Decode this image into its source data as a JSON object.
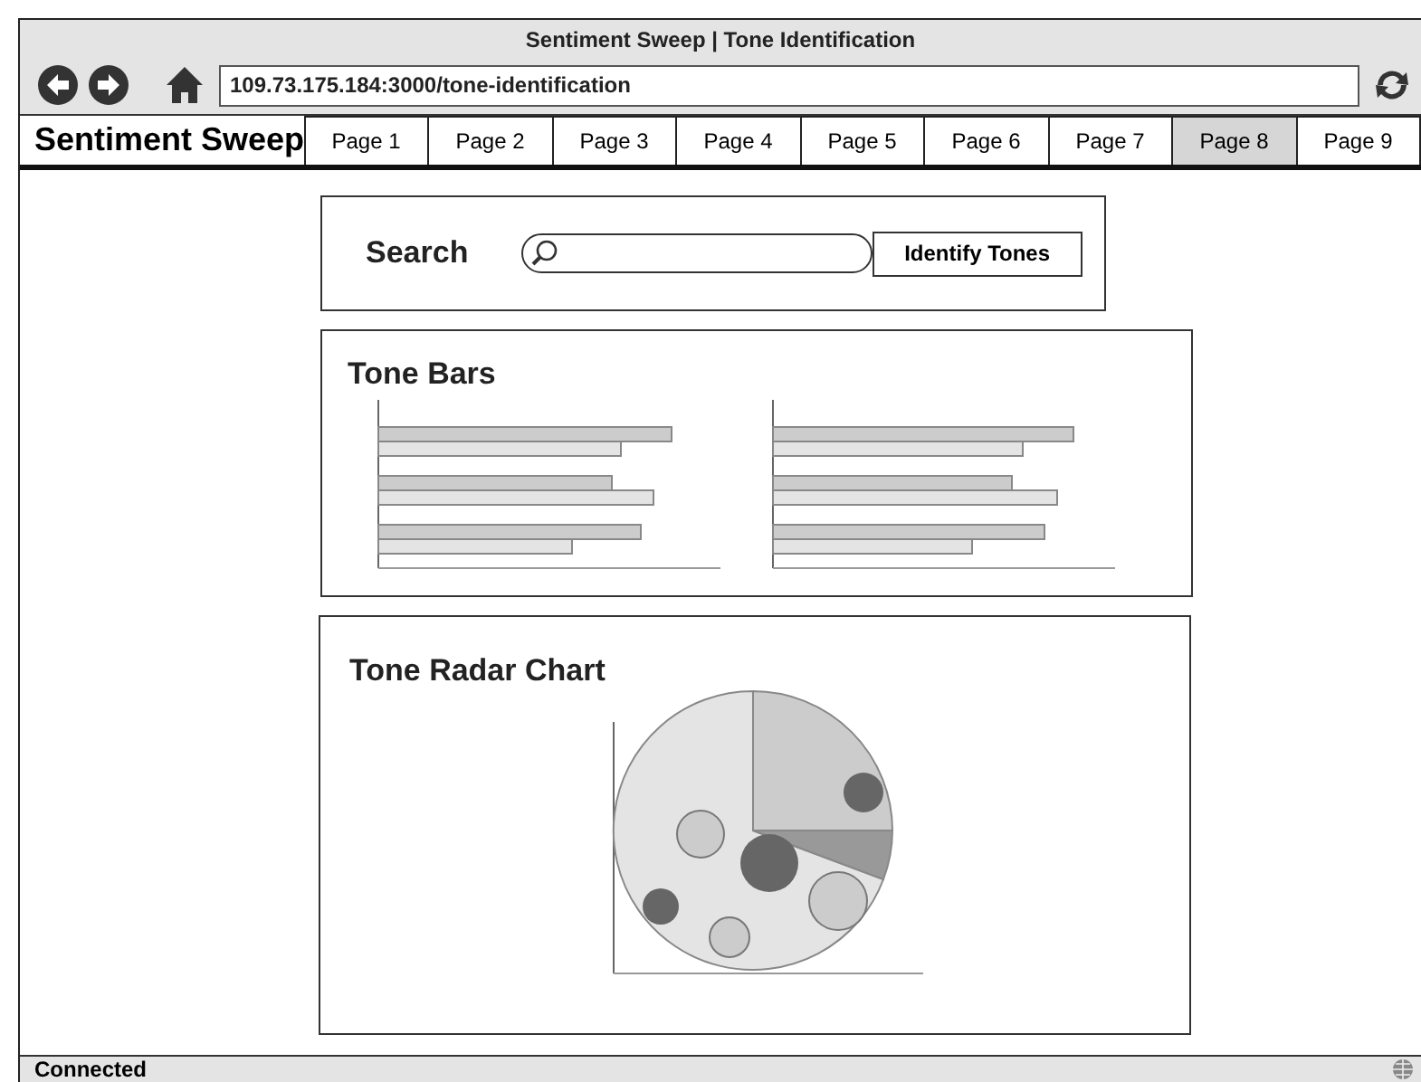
{
  "window": {
    "title": "Sentiment Sweep | Tone Identification",
    "url": "109.73.175.184:3000/tone-identification"
  },
  "nav": {
    "brand": "Sentiment Sweep",
    "tabs": [
      {
        "label": "Page 1",
        "selected": false
      },
      {
        "label": "Page 2",
        "selected": false
      },
      {
        "label": "Page 3",
        "selected": false
      },
      {
        "label": "Page 4",
        "selected": false
      },
      {
        "label": "Page 5",
        "selected": false
      },
      {
        "label": "Page 6",
        "selected": false
      },
      {
        "label": "Page 7",
        "selected": false
      },
      {
        "label": "Page 8",
        "selected": true
      },
      {
        "label": "Page 9",
        "selected": false
      }
    ]
  },
  "search": {
    "label": "Search",
    "button": "Identify Tones"
  },
  "tone_bars": {
    "title": "Tone Bars"
  },
  "tone_radar": {
    "title": "Tone Radar Chart"
  },
  "status_bar": {
    "text": "Connected"
  }
}
